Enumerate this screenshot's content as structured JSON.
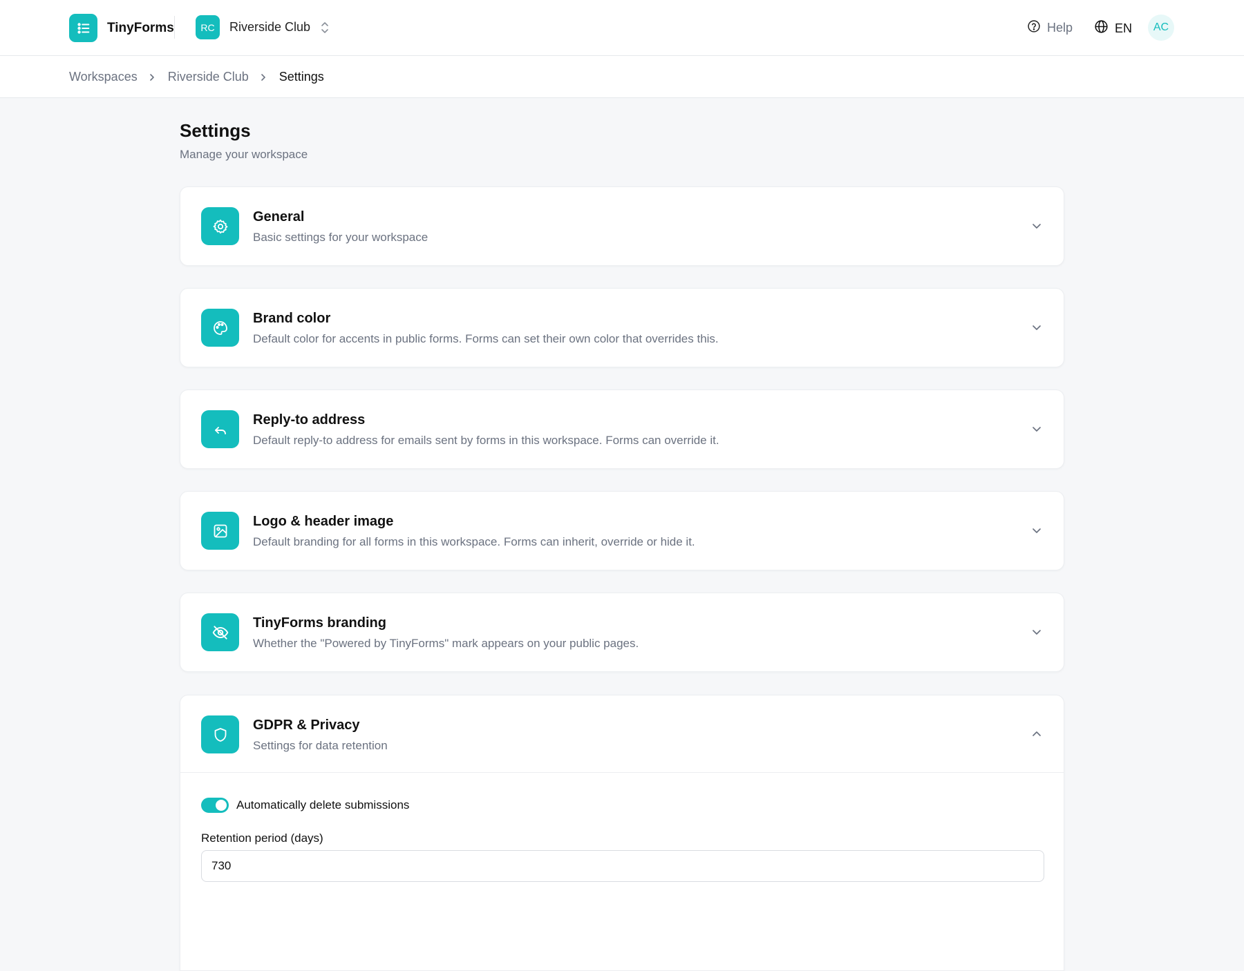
{
  "app": {
    "name": "TinyForms"
  },
  "workspace": {
    "initials": "RC",
    "name": "Riverside Club"
  },
  "header": {
    "help_label": "Help",
    "language": "EN",
    "user_initials": "AC"
  },
  "breadcrumb": [
    "Workspaces",
    "Riverside Club",
    "Settings"
  ],
  "page": {
    "title": "Settings",
    "subtitle": "Manage your workspace"
  },
  "sections": [
    {
      "title": "General",
      "description": "Basic settings for your workspace",
      "icon": "gear-icon",
      "expanded": false
    },
    {
      "title": "Brand color",
      "description": "Default color for accents in public forms. Forms can set their own color that overrides this.",
      "icon": "palette-icon",
      "expanded": false
    },
    {
      "title": "Reply-to address",
      "description": "Default reply-to address for emails sent by forms in this workspace. Forms can override it.",
      "icon": "reply-icon",
      "expanded": false
    },
    {
      "title": "Logo & header image",
      "description": "Default branding for all forms in this workspace. Forms can inherit, override or hide it.",
      "icon": "image-icon",
      "expanded": false
    },
    {
      "title": "TinyForms branding",
      "description": "Whether the \"Powered by TinyForms\" mark appears on your public pages.",
      "icon": "eye-off-icon",
      "expanded": false
    },
    {
      "title": "GDPR & Privacy",
      "description": "Settings for data retention",
      "icon": "shield-icon",
      "expanded": true
    }
  ],
  "gdpr": {
    "auto_delete_label": "Automatically delete submissions",
    "auto_delete_enabled": true,
    "retention_label": "Retention period (days)",
    "retention_value": "730"
  },
  "colors": {
    "accent": "#14bdbd"
  }
}
